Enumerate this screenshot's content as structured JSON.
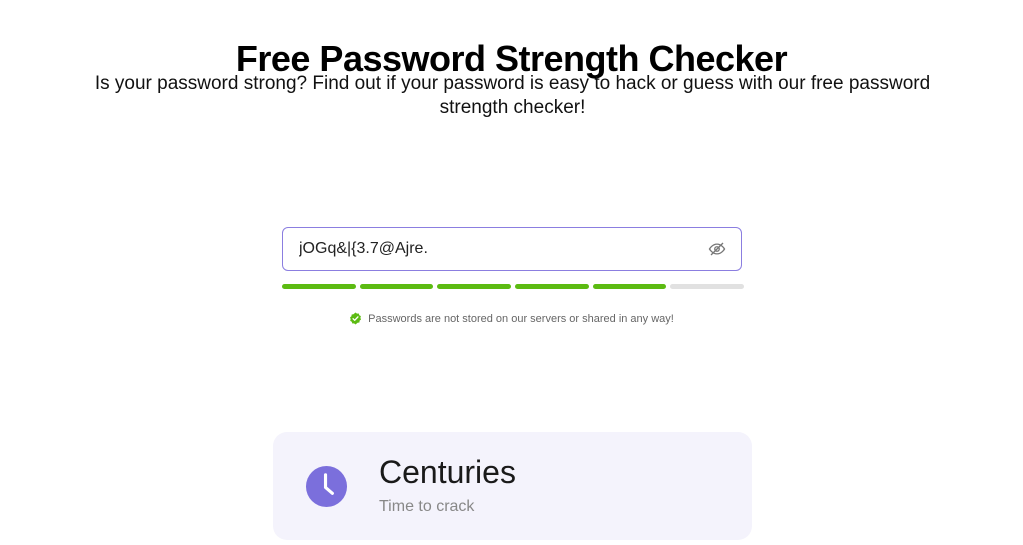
{
  "header": {
    "title": "Free Password Strength Checker",
    "subtitle": "Is your password strong? Find out if your password is easy to hack or guess with our free password strength checker!"
  },
  "password_field": {
    "value": "jOGq&|{3.7@Ajre.",
    "toggle_icon": "eye-icon"
  },
  "strength_meter": {
    "segments_total": 6,
    "segments_filled": 5,
    "filled_color": "#5cbb12",
    "empty_color": "#e1e1e1"
  },
  "privacy_notice": {
    "icon": "check-badge-icon",
    "text": "Passwords are not stored on our servers or shared in any way!"
  },
  "result": {
    "icon": "clock-icon",
    "value": "Centuries",
    "label": "Time to crack",
    "accent_color": "#7b6fdc"
  }
}
